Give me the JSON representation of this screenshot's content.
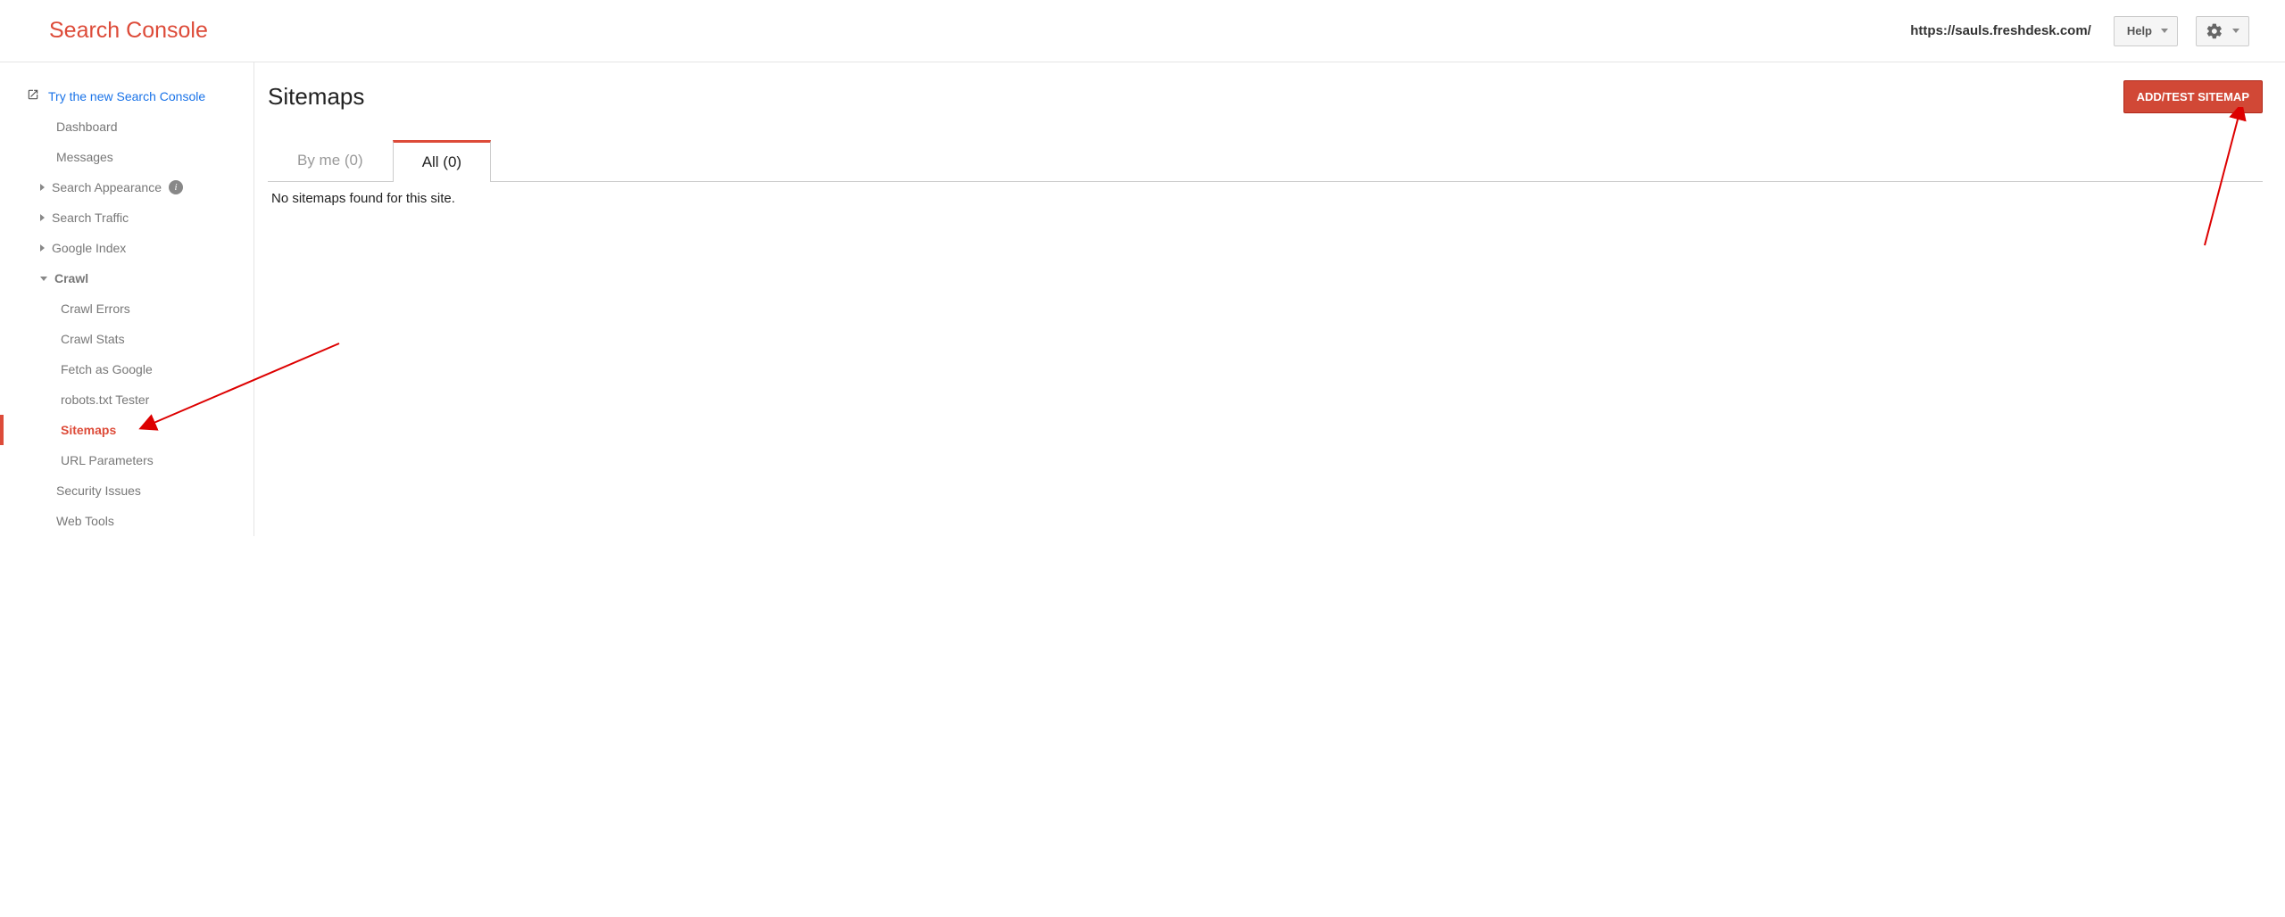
{
  "header": {
    "logo": "Search Console",
    "property_url": "https://sauls.freshdesk.com/",
    "help_label": "Help"
  },
  "sidebar": {
    "try_link": "Try the new Search Console",
    "dashboard": "Dashboard",
    "messages": "Messages",
    "search_appearance": "Search Appearance",
    "search_traffic": "Search Traffic",
    "google_index": "Google Index",
    "crawl": "Crawl",
    "crawl_children": {
      "crawl_errors": "Crawl Errors",
      "crawl_stats": "Crawl Stats",
      "fetch_as_google": "Fetch as Google",
      "robots_tester": "robots.txt Tester",
      "sitemaps": "Sitemaps",
      "url_parameters": "URL Parameters"
    },
    "security_issues": "Security Issues",
    "web_tools": "Web Tools"
  },
  "main": {
    "title": "Sitemaps",
    "add_button": "ADD/TEST SITEMAP",
    "tabs": {
      "by_me": "By me (0)",
      "all": "All (0)"
    },
    "empty_message": "No sitemaps found for this site."
  }
}
